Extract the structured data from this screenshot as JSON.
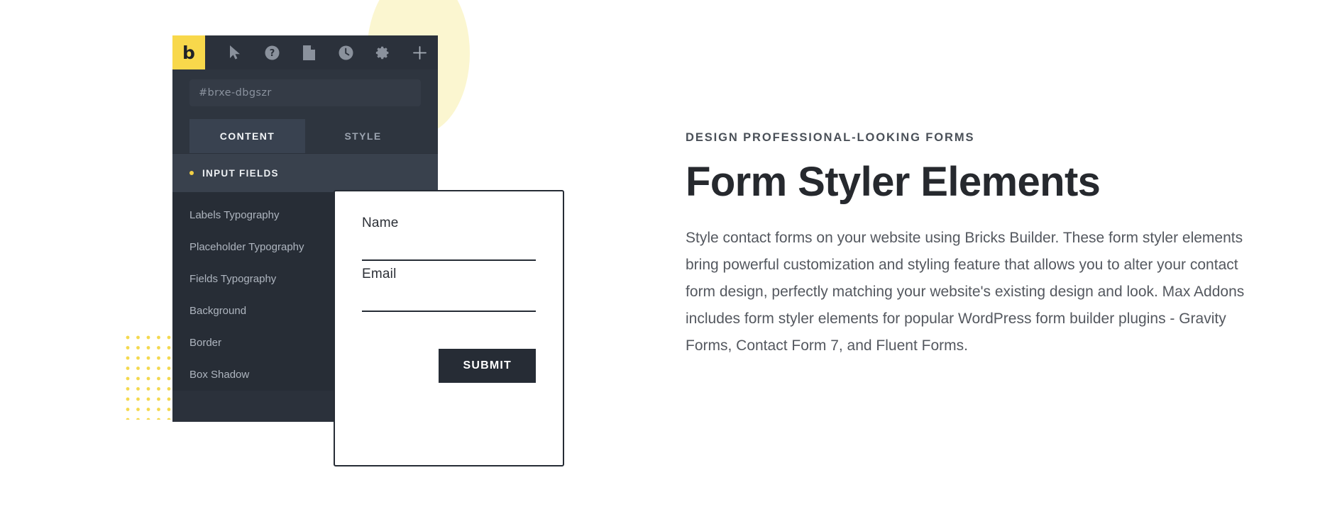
{
  "colors": {
    "brand_yellow": "#F8D84B",
    "panel_dark": "#2B313B",
    "panel_body": "#2E353F",
    "panel_list": "#272D36",
    "ink": "#262C35",
    "pale_yellow": "#FBF6D0"
  },
  "builder_panel": {
    "logo_letter": "b",
    "toolbar_icons": [
      {
        "name": "cursor-icon",
        "label": "Select"
      },
      {
        "name": "help-icon",
        "label": "Help"
      },
      {
        "name": "page-icon",
        "label": "Page"
      },
      {
        "name": "history-clock-icon",
        "label": "Revisions"
      },
      {
        "name": "gear-icon",
        "label": "Settings"
      },
      {
        "name": "plus-icon",
        "label": "Add Element"
      }
    ],
    "element_id": "#brxe-dbgszr",
    "tabs": [
      {
        "label": "CONTENT",
        "active": true
      },
      {
        "label": "STYLE",
        "active": false
      }
    ],
    "section_label": "INPUT FIELDS",
    "settings": [
      "Labels Typography",
      "Placeholder Typography",
      "Fields Typography",
      "Background",
      "Border",
      "Box Shadow"
    ]
  },
  "form_preview": {
    "fields": [
      {
        "label": "Name",
        "value": ""
      },
      {
        "label": "Email",
        "value": ""
      }
    ],
    "submit_label": "SUBMIT"
  },
  "content": {
    "eyebrow": "DESIGN PROFESSIONAL-LOOKING FORMS",
    "headline": "Form Styler Elements",
    "body": "Style contact forms on your website using Bricks Builder. These form styler elements bring powerful customization and styling feature that allows you to alter your contact form design, perfectly matching your website's existing design and look. Max Addons includes form styler elements for popular WordPress form builder plugins - Gravity Forms, Contact Form 7, and Fluent Forms."
  }
}
